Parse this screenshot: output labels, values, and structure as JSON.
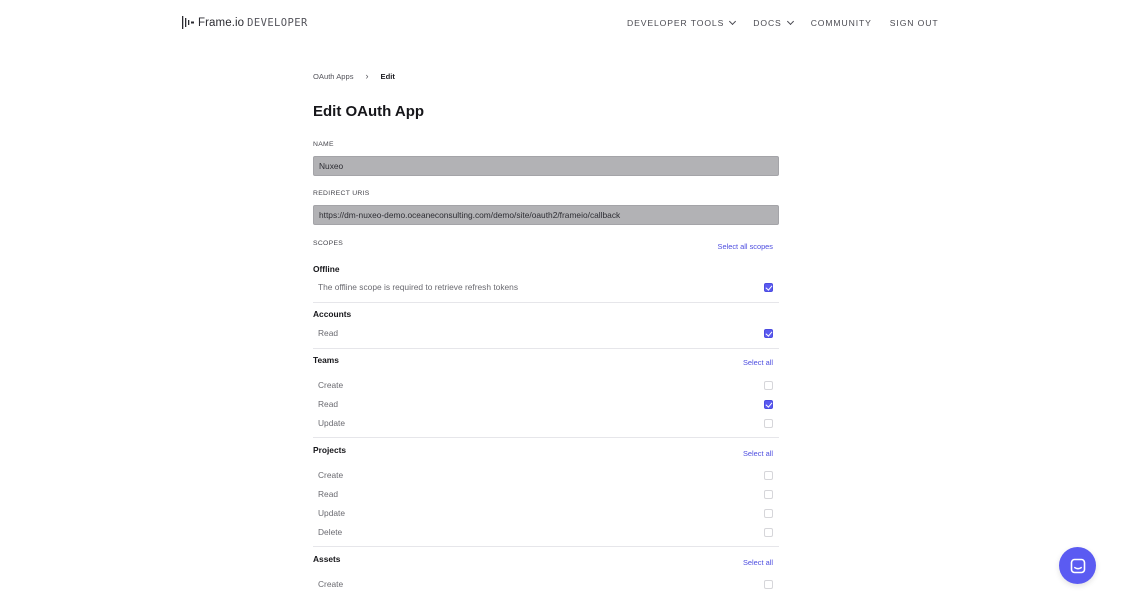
{
  "brand": {
    "name": "Frame.io",
    "sub": "DEVELOPER"
  },
  "nav": {
    "items": [
      {
        "label": "DEVELOPER TOOLS",
        "dropdown": true
      },
      {
        "label": "DOCS",
        "dropdown": true
      },
      {
        "label": "COMMUNITY",
        "dropdown": false
      },
      {
        "label": "SIGN OUT",
        "dropdown": false
      }
    ]
  },
  "breadcrumb": {
    "parent": "OAuth Apps",
    "separator": "›",
    "current": "Edit"
  },
  "page": {
    "title": "Edit OAuth App"
  },
  "form": {
    "name_label": "NAME",
    "name_value": "Nuxeo",
    "redirect_label": "REDIRECT URIS",
    "redirect_value": "https://dm-nuxeo-demo.oceaneconsulting.com/demo/site/oauth2/frameio/callback",
    "scopes_label": "SCOPES",
    "select_all_scopes": "Select all scopes"
  },
  "scopes": {
    "offline": {
      "title": "Offline",
      "rows": [
        {
          "label": "The offline scope is required to retrieve refresh tokens",
          "checked": true
        }
      ]
    },
    "accounts": {
      "title": "Accounts",
      "rows": [
        {
          "label": "Read",
          "checked": true
        }
      ]
    },
    "teams": {
      "title": "Teams",
      "select_all": "Select all",
      "rows": [
        {
          "label": "Create",
          "checked": false
        },
        {
          "label": "Read",
          "checked": true
        },
        {
          "label": "Update",
          "checked": false
        }
      ]
    },
    "projects": {
      "title": "Projects",
      "select_all": "Select all",
      "rows": [
        {
          "label": "Create",
          "checked": false
        },
        {
          "label": "Read",
          "checked": false
        },
        {
          "label": "Update",
          "checked": false
        },
        {
          "label": "Delete",
          "checked": false
        }
      ]
    },
    "assets": {
      "title": "Assets",
      "select_all": "Select all",
      "rows": [
        {
          "label": "Create",
          "checked": false
        }
      ]
    }
  },
  "colors": {
    "accent": "#5b5bf2",
    "link": "#4e4ee0",
    "input_bg": "#b2b2b5"
  },
  "icons": {
    "brand": "frameio-logo-icon",
    "chat": "chat-launcher-icon"
  }
}
